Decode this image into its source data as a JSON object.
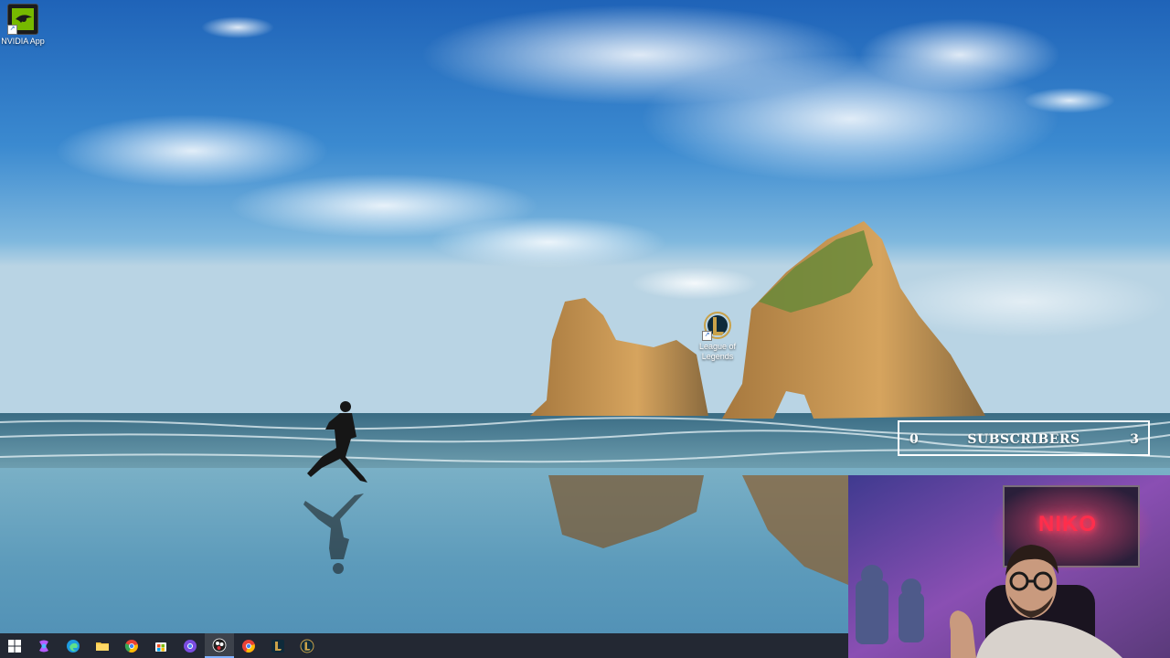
{
  "desktop": {
    "icons": [
      {
        "label": "NVIDIA App",
        "icon": "nvidia-app-icon"
      },
      {
        "label": "League of Legends",
        "icon": "league-of-legends-icon"
      }
    ]
  },
  "overlay": {
    "subscribers": {
      "left_value": "0",
      "label": "SUBSCRIBERS",
      "right_value": "3"
    },
    "webcam": {
      "neon_sign": "NIKO"
    }
  },
  "taskbar": {
    "items": [
      {
        "icon": "windows-start-icon"
      },
      {
        "icon": "copilot-icon"
      },
      {
        "icon": "edge-icon"
      },
      {
        "icon": "file-explorer-icon"
      },
      {
        "icon": "chrome-icon"
      },
      {
        "icon": "microsoft-store-icon"
      },
      {
        "icon": "chrome-profile-icon"
      },
      {
        "icon": "obs-studio-icon",
        "active": true
      },
      {
        "icon": "chrome-profile-2-icon"
      },
      {
        "icon": "league-client-icon"
      },
      {
        "icon": "league-of-legends-taskbar-icon"
      }
    ]
  },
  "colors": {
    "accent_taskbar": "#7fb0ff",
    "neon": "#ff2e4c"
  }
}
